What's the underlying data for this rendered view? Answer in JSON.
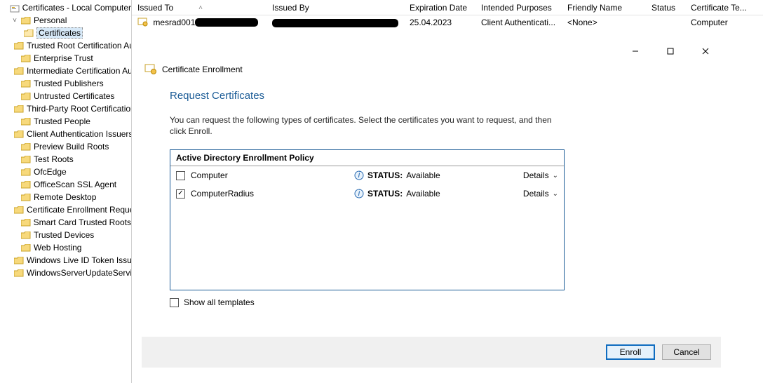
{
  "tree": {
    "root": "Certificates - Local Computer",
    "personal": "Personal",
    "certificates": "Certificates",
    "items": [
      "Trusted Root Certification Au",
      "Enterprise Trust",
      "Intermediate Certification Au",
      "Trusted Publishers",
      "Untrusted Certificates",
      "Third-Party Root Certification",
      "Trusted People",
      "Client Authentication Issuers",
      "Preview Build Roots",
      "Test Roots",
      "OfcEdge",
      "OfficeScan SSL Agent",
      "Remote Desktop",
      "Certificate Enrollment Reques",
      "Smart Card Trusted Roots",
      "Trusted Devices",
      "Web Hosting",
      "Windows Live ID Token Issuer",
      "WindowsServerUpdateService"
    ]
  },
  "columns": {
    "issued_to": "Issued To",
    "issued_by": "Issued By",
    "expiration": "Expiration Date",
    "purposes": "Intended Purposes",
    "friendly": "Friendly Name",
    "status": "Status",
    "template": "Certificate Te..."
  },
  "row": {
    "issued_to": "mesrad001",
    "expiration": "25.04.2023",
    "purposes": "Client Authenticati...",
    "friendly": "<None>",
    "template": "Computer"
  },
  "dialog": {
    "header": "Certificate Enrollment",
    "title": "Request Certificates",
    "text1": "You can request the following types of certificates. Select the certificates you want to request, and then click Enroll.",
    "policy_title": "Active Directory Enrollment Policy",
    "templates": [
      {
        "name": "Computer",
        "checked": false,
        "status_label": "STATUS:",
        "status": "Available",
        "details": "Details"
      },
      {
        "name": "ComputerRadius",
        "checked": true,
        "status_label": "STATUS:",
        "status": "Available",
        "details": "Details"
      }
    ],
    "show_all": "Show all templates",
    "enroll": "Enroll",
    "cancel": "Cancel"
  }
}
